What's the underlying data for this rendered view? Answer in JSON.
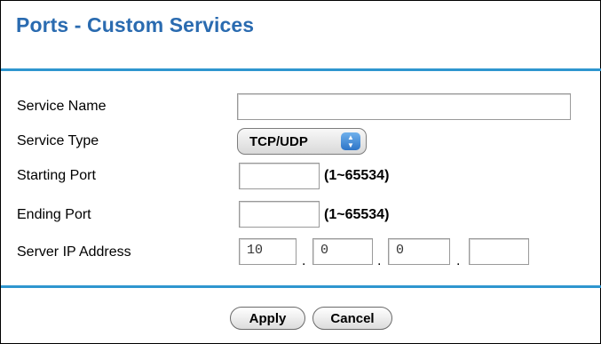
{
  "title": "Ports - Custom Services",
  "fields": {
    "service_name": {
      "label": "Service Name",
      "value": ""
    },
    "service_type": {
      "label": "Service Type",
      "selected": "TCP/UDP"
    },
    "starting_port": {
      "label": "Starting Port",
      "value": "",
      "hint": "(1~65534)"
    },
    "ending_port": {
      "label": "Ending Port",
      "value": "",
      "hint": "(1~65534)"
    },
    "server_ip": {
      "label": "Server IP Address",
      "octets": [
        "10",
        "0",
        "0",
        ""
      ],
      "separator": "."
    }
  },
  "buttons": {
    "apply": "Apply",
    "cancel": "Cancel"
  },
  "icons": {
    "select_arrows": "updown-chevron-icon"
  },
  "colors": {
    "title": "#2a6bb0",
    "rule": "#2f96cf",
    "select_arrow": "#2d74c7"
  }
}
